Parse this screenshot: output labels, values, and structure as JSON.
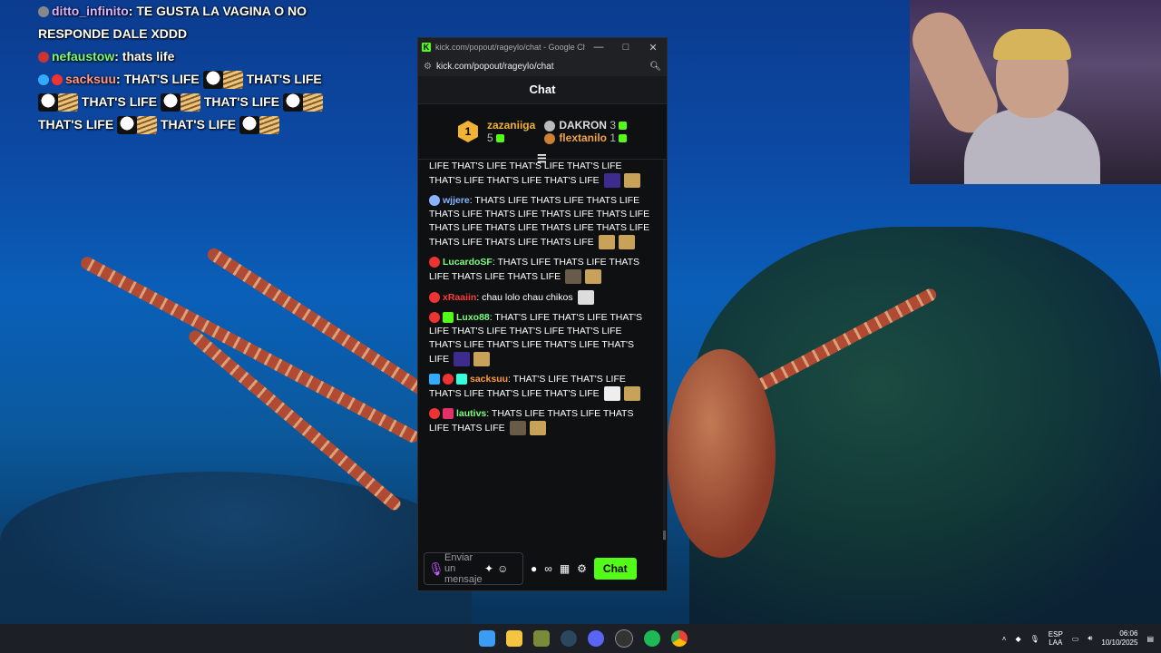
{
  "overlay_chat": {
    "lines": [
      {
        "user": "ditto_infinito",
        "text": ": TE GUSTA LA VAGINA O NO RESPONDE DALE XDDD"
      },
      {
        "user": "nefaustow",
        "text": ": thats life"
      },
      {
        "user": "sacksuu",
        "text": ": THAT'S LIFE",
        "repeat": [
          "THAT'S LIFE",
          "THAT'S LIFE",
          "THAT'S LIFE",
          "THAT'S LIFE",
          "THAT'S LIFE"
        ]
      }
    ]
  },
  "window": {
    "title": "kick.com/popout/rageylo/chat - Google Chro...",
    "url": "kick.com/popout/rageylo/chat",
    "minimize_label": "—",
    "maximize_label": "□",
    "close_label": "✕"
  },
  "chat": {
    "header": "Chat",
    "leaderboard": {
      "first": {
        "name": "zazaniiga",
        "rank": "1",
        "count": "5"
      },
      "second": {
        "name": "DAKRON",
        "count": "3"
      },
      "third": {
        "name": "flextanilo",
        "count": "1"
      }
    },
    "messages": [
      {
        "user": "",
        "text": "LIFE THAT'S LIFE THAT'S LIFE THAT'S LIFE THAT'S LIFE THAT'S LIFE THAT'S LIFE"
      },
      {
        "user": "wjjere",
        "text": ": THATS LIFE THATS LIFE THATS LIFE THATS LIFE THATS LIFE THATS LIFE THATS LIFE THATS LIFE THATS LIFE THATS LIFE THATS LIFE THATS LIFE THATS LIFE THATS LIFE"
      },
      {
        "user": "LucardoSF",
        "text": ": THATS LIFE THATS LIFE THATS LIFE THATS LIFE THATS LIFE"
      },
      {
        "user": "xRaaiin",
        "text": ": chau lolo chau chikos"
      },
      {
        "user": "Luxo88",
        "text": ": THAT'S LIFE THAT'S LIFE THAT'S LIFE THAT'S LIFE THAT'S LIFE THAT'S LIFE THAT'S LIFE THAT'S LIFE THAT'S LIFE THAT'S LIFE"
      },
      {
        "user": "sacksuu",
        "text": ": THAT'S LIFE THAT'S LIFE THAT'S LIFE THAT'S LIFE THAT'S LIFE"
      },
      {
        "user": "lautivs",
        "text": ": THATS LIFE THATS LIFE THATS LIFE THATS LIFE"
      }
    ],
    "input_placeholder": "Enviar un mensaje",
    "send_label": "Chat"
  },
  "tray": {
    "lang_top": "ESP",
    "lang_bottom": "LAA",
    "time": "06:06",
    "date": "10/10/2025"
  },
  "colors": {
    "kick_green": "#53fc18",
    "gold": "#f2b233"
  }
}
